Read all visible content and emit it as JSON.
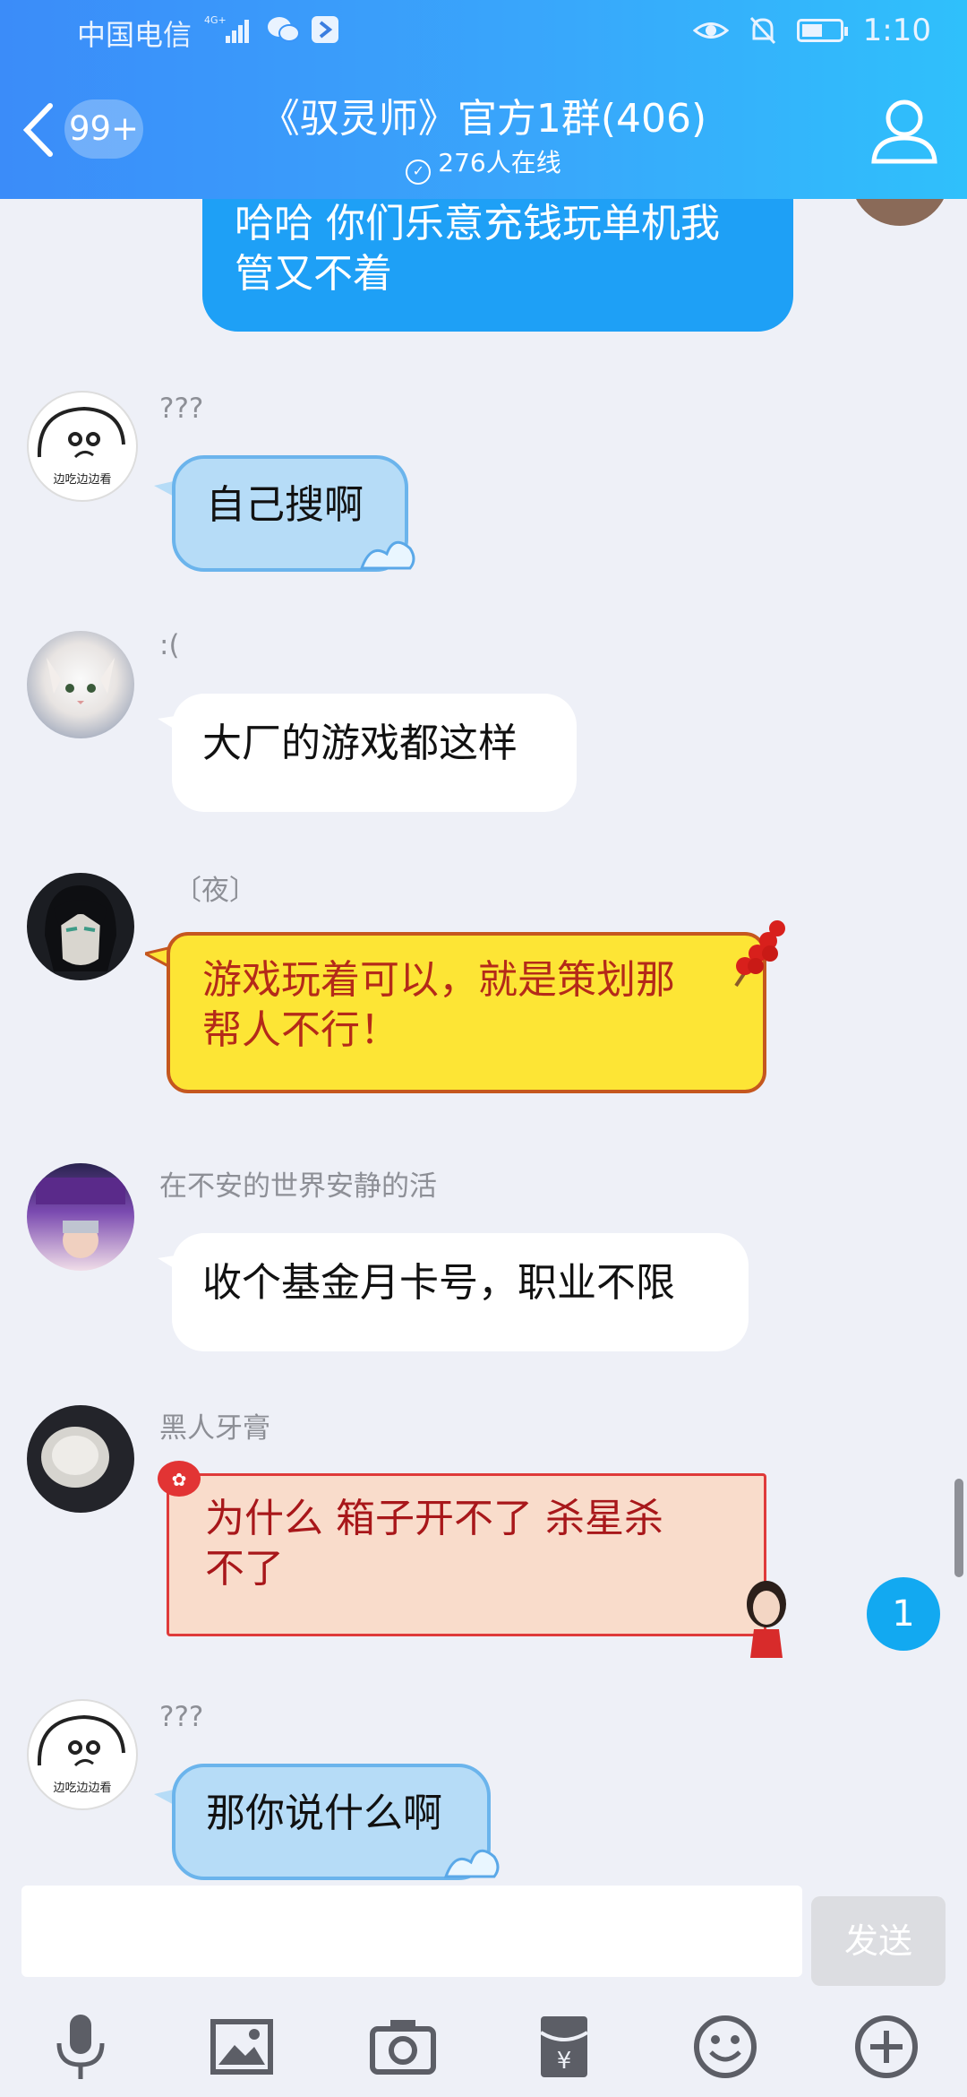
{
  "status_bar": {
    "carrier": "中国电信",
    "network": "4G+",
    "time": "1:10"
  },
  "header": {
    "back_badge": "99+",
    "title": "《驭灵师》官方1群(406)",
    "online": "276人在线"
  },
  "messages": [
    {
      "sender": "",
      "text": "哈哈 你们乐意充钱玩单机我管又不着",
      "lines": [
        "哈哈 你们乐意充钱玩单机我",
        "管又不着"
      ],
      "style": "self"
    },
    {
      "sender": "???",
      "text": "自己搜啊",
      "style": "blue",
      "avatar": "face-doodle",
      "avatar_text": "边吃边边看"
    },
    {
      "sender": ":(",
      "text": "大厂的游戏都这样",
      "style": "white",
      "avatar": "white-cat"
    },
    {
      "sender": "〔夜〕",
      "lines": [
        "游戏玩着可以，就是策划那",
        "帮人不行！"
      ],
      "style": "yellow",
      "avatar": "anime-boy"
    },
    {
      "sender": "在不安的世界安静的活",
      "text": "收个基金月卡号，职业不限",
      "style": "white",
      "avatar": "anime-collage"
    },
    {
      "sender": "黑人牙膏",
      "lines": [
        "为什么 箱子开不了 杀星杀",
        "不了"
      ],
      "style": "peach",
      "avatar": "toothpaste-dish"
    },
    {
      "sender": "???",
      "text": "那你说什么啊",
      "style": "blue",
      "avatar": "face-doodle",
      "avatar_text": "边吃边边看"
    }
  ],
  "unread_count": "1",
  "composer": {
    "placeholder": "",
    "send_label": "发送"
  },
  "toolbar": [
    "microphone-icon",
    "image-icon",
    "camera-icon",
    "red-packet-icon",
    "emoji-icon",
    "plus-icon"
  ],
  "colors": {
    "header_start": "#3b8cf9",
    "header_end": "#2fc0fb",
    "self_bubble": "#1ea0f6",
    "unread_badge": "#12a9f1"
  }
}
